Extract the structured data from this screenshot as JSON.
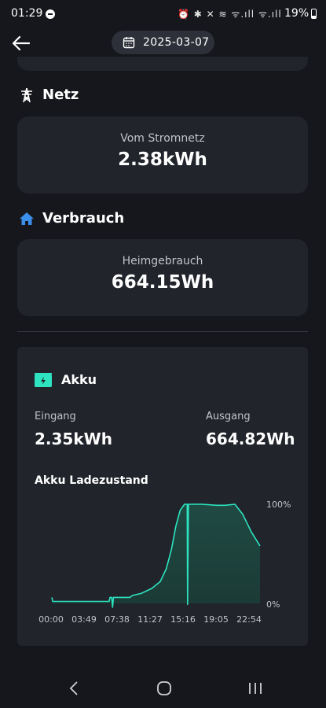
{
  "status_bar": {
    "time": "01:29",
    "icons": "⏰ ✱ ✕ ≋ ᯤ.ıll ᯤ.ıll",
    "battery": "19%"
  },
  "header": {
    "date": "2025-03-07"
  },
  "netz": {
    "title": "Netz",
    "label": "Vom Stromnetz",
    "value": "2.38kWh"
  },
  "verbrauch": {
    "title": "Verbrauch",
    "label": "Heimgebrauch",
    "value": "664.15Wh"
  },
  "akku": {
    "title": "Akku",
    "in_label": "Eingang",
    "in_value": "2.35kWh",
    "out_label": "Ausgang",
    "out_value": "664.82Wh",
    "chart_title": "Akku Ladezustand"
  },
  "colors": {
    "accent": "#2de3c0",
    "card": "#22242c",
    "background": "#16171c",
    "house_blue": "#3b8eea"
  },
  "chart_data": {
    "type": "area",
    "title": "Akku Ladezustand",
    "x_ticks": [
      "00:00",
      "03:49",
      "07:38",
      "11:27",
      "15:16",
      "19:05",
      "22:54"
    ],
    "y_ticks": [
      "100%",
      "0%"
    ],
    "ylim": [
      0,
      100
    ],
    "xlim_hours": [
      0,
      24
    ],
    "series": [
      {
        "points": [
          [
            0.0,
            6
          ],
          [
            0.1,
            2
          ],
          [
            2.0,
            2
          ],
          [
            4.0,
            2
          ],
          [
            6.6,
            2
          ],
          [
            6.7,
            6
          ],
          [
            6.9,
            6
          ],
          [
            7.0,
            -4
          ],
          [
            7.1,
            6
          ],
          [
            9.0,
            6
          ],
          [
            9.3,
            8
          ],
          [
            10.3,
            10
          ],
          [
            11.5,
            15
          ],
          [
            12.5,
            22
          ],
          [
            13.2,
            35
          ],
          [
            13.8,
            55
          ],
          [
            14.3,
            78
          ],
          [
            14.8,
            94
          ],
          [
            15.3,
            100
          ],
          [
            15.6,
            100
          ],
          [
            15.65,
            -1
          ],
          [
            15.75,
            100
          ],
          [
            17.0,
            100
          ],
          [
            17.3,
            100
          ],
          [
            19.0,
            99
          ],
          [
            20.0,
            99
          ],
          [
            21.1,
            100
          ],
          [
            22.0,
            90
          ],
          [
            23.0,
            72
          ],
          [
            24.0,
            58
          ]
        ]
      }
    ]
  },
  "nav": {
    "back": "‹",
    "home": "○",
    "recents": "|||"
  }
}
